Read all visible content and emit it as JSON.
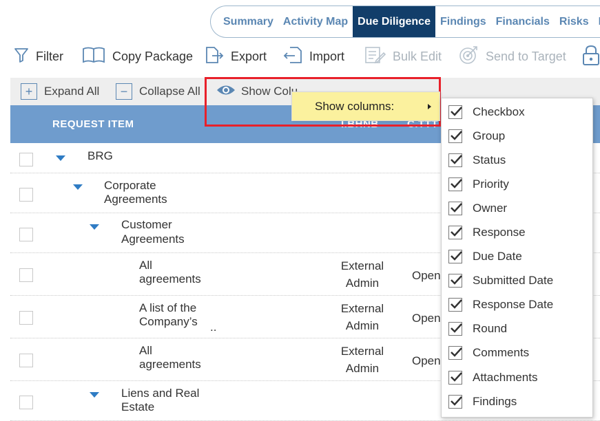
{
  "tabs": [
    {
      "label": "Summary",
      "active": false
    },
    {
      "label": "Activity Map",
      "active": false
    },
    {
      "label": "Due Diligence",
      "active": true
    },
    {
      "label": "Findings",
      "active": false
    },
    {
      "label": "Financials",
      "active": false
    },
    {
      "label": "Risks",
      "active": false
    },
    {
      "label": "Issu",
      "active": false
    }
  ],
  "toolbar": {
    "filter": "Filter",
    "copy_package": "Copy Package",
    "export": "Export",
    "import": "Import",
    "bulk_edit": "Bulk Edit",
    "send_to_target": "Send to Target"
  },
  "subbar": {
    "expand_all": "Expand All",
    "collapse_all": "Collapse All",
    "show_columns": "Show Colu"
  },
  "table": {
    "header": {
      "request_item": "REQUEST ITEM",
      "col2": "I.BHNB",
      "col3": "C.TTT"
    },
    "rows": [
      {
        "line1": "BRG",
        "line2": ""
      },
      {
        "line1": "Corporate",
        "line2": "Agreements"
      },
      {
        "line1": "Customer",
        "line2": "Agreements"
      },
      {
        "line1": "All",
        "line2": "agreements",
        "owner1": "External",
        "owner2": "Admin",
        "status": "Open"
      },
      {
        "line1": "A list of the",
        "line2": "Company’s",
        "ellipsis": "..",
        "owner1": "External",
        "owner2": "Admin",
        "status": "Open"
      },
      {
        "line1": "All",
        "line2": "agreements",
        "owner1": "External",
        "owner2": "Admin",
        "status": "Open"
      },
      {
        "line1": "Liens and Real",
        "line2": "Estate"
      }
    ]
  },
  "show_columns_menu": {
    "label": "Show columns:",
    "items": [
      "Checkbox",
      "Group",
      "Status",
      "Priority",
      "Owner",
      "Response",
      "Due Date",
      "Submitted Date",
      "Response Date",
      "Round",
      "Comments",
      "Attachments",
      "Findings"
    ]
  },
  "colors": {
    "accent": "#123e6a",
    "tab_text": "#5b87b3",
    "header_bg": "#6f9ccd",
    "highlight": "#fbf19e",
    "red_outline": "#e8202a"
  }
}
